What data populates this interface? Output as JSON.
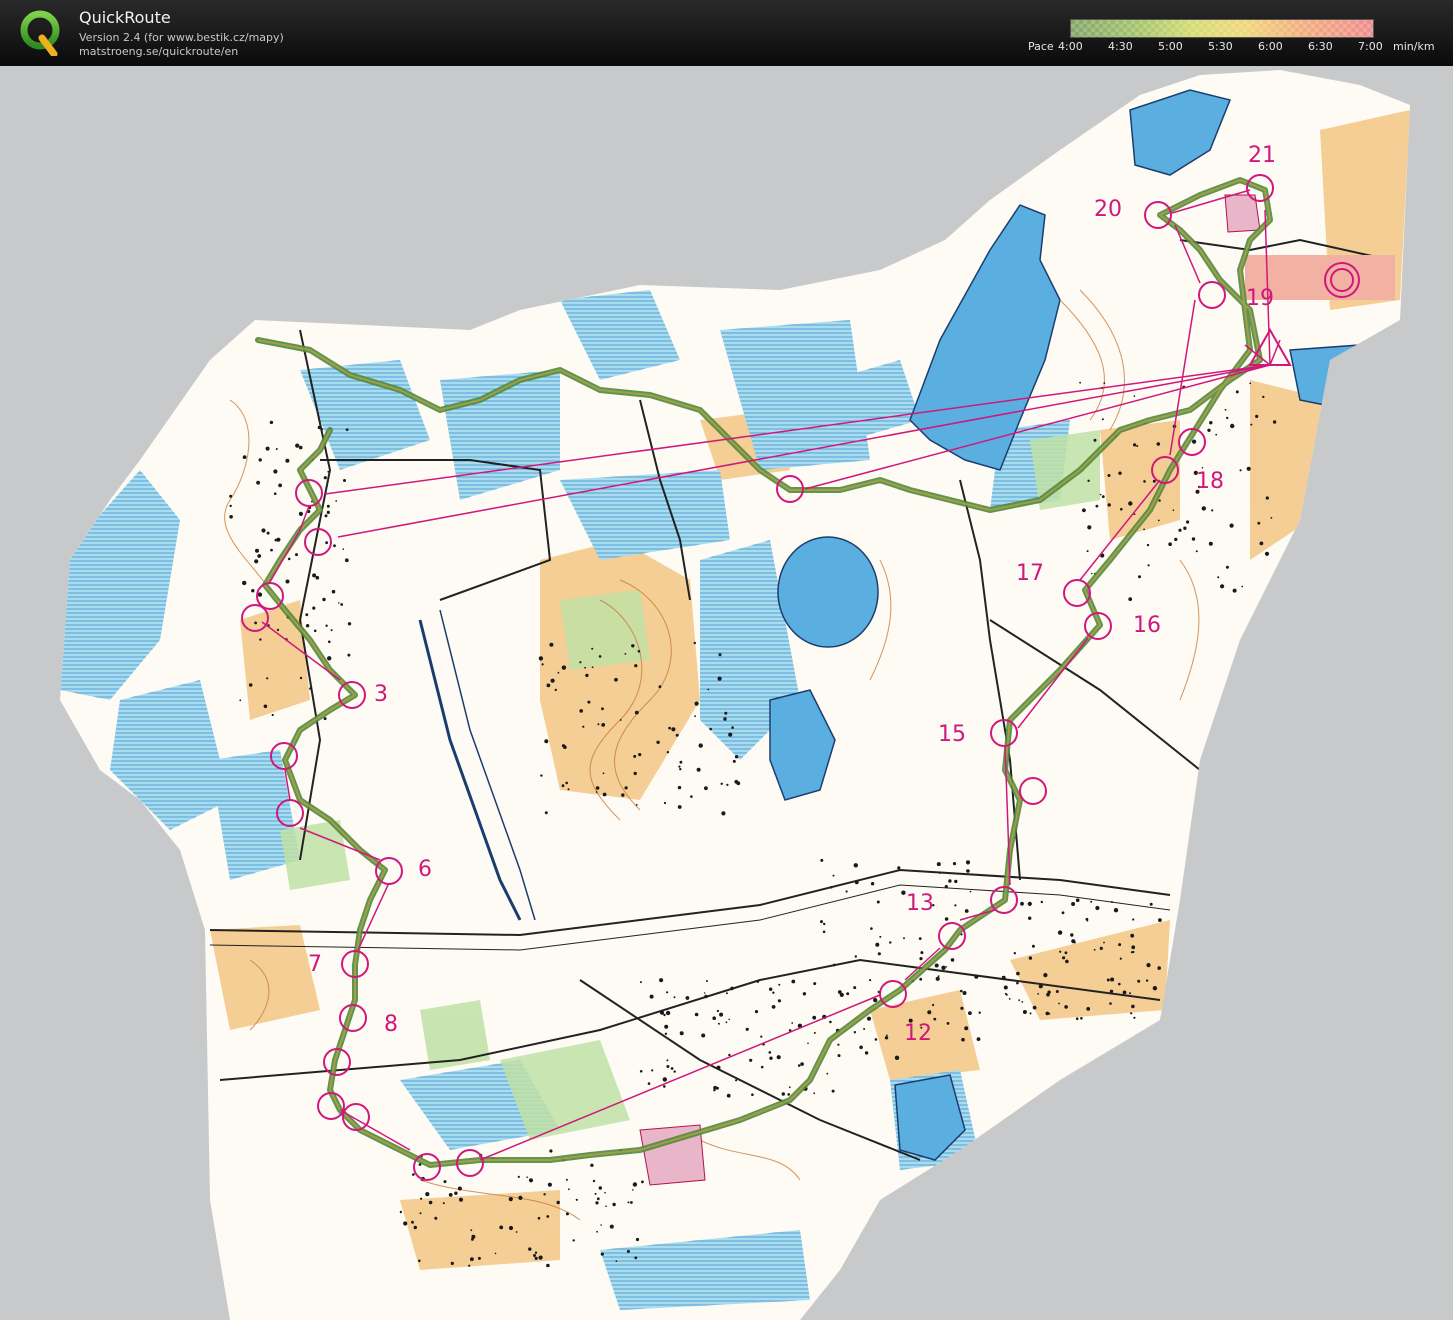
{
  "app": {
    "title": "QuickRoute",
    "version_line": "Version 2.4  (for www.bestik.cz/mapy)",
    "url_line": "matstroeng.se/quickroute/en"
  },
  "pace_legend": {
    "prefix": "Pace",
    "ticks": [
      "4:00",
      "4:30",
      "5:00",
      "5:30",
      "6:00",
      "6:30",
      "7:00"
    ],
    "unit": "min/km"
  },
  "colors": {
    "course": "#d0187c",
    "route": "#4e8a3c",
    "water": "#7ec8e3",
    "lake": "#5aaee0",
    "open_land": "#f0c07a",
    "contour": "#c77b3a",
    "background": "#c8c9cb"
  },
  "course": {
    "control_labels": [
      "3",
      "6",
      "7",
      "8",
      "12",
      "13",
      "15",
      "16",
      "17",
      "18",
      "19",
      "20",
      "21"
    ]
  }
}
